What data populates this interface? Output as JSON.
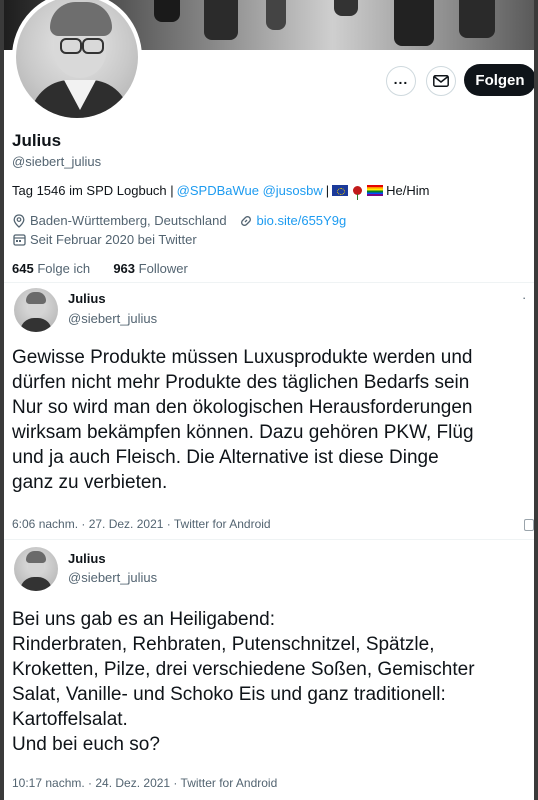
{
  "profile": {
    "name": "Julius",
    "handle": "@siebert_julius",
    "bio_prefix": "Tag 1546 im SPD Logbuch |",
    "bio_mentions": "@SPDBaWue @jusosbw",
    "bio_sep": "|",
    "bio_suffix": "He/Him",
    "location": "Baden-Württemberg, Deutschland",
    "website": "bio.site/655Y9g",
    "joined": "Seit Februar 2020 bei Twitter",
    "following_count": "645",
    "following_label": "Folge ich",
    "followers_count": "963",
    "followers_label": "Follower",
    "follow_button": "Folgen",
    "more_icon": "more-icon",
    "message_icon": "envelope-icon"
  },
  "tweets": [
    {
      "name": "Julius",
      "handle": "@siebert_julius",
      "more": "·",
      "text": "Gewisse Produkte müssen Luxusprodukte werden und\ndürfen nicht mehr Produkte des täglichen Bedarfs sein\nNur so wird man den ökologischen Herausforderungen\nwirksam bekämpfen können. Dazu gehören PKW, Flüg\nund ja auch Fleisch. Die Alternative ist diese Dinge\nganz zu verbieten.",
      "time": "6:06 nachm. · 27. Dez. 2021 · Twitter for Android"
    },
    {
      "name": "Julius",
      "handle": "@siebert_julius",
      "text": "Bei uns gab es an Heiligabend:\nRinderbraten, Rehbraten, Putenschnitzel, Spätzle,\nKroketten, Pilze, drei verschiedene Soßen, Gemischter\nSalat, Vanille- und Schoko Eis und ganz traditionell:\nKartoffelsalat.\nUnd bei euch so?",
      "time": "10:17 nachm. · 24. Dez. 2021 · Twitter for Android"
    }
  ],
  "colors": {
    "link": "#1d9bf0",
    "text": "#0f1419",
    "secondary": "#536471",
    "follow_bg": "#0f1419"
  }
}
